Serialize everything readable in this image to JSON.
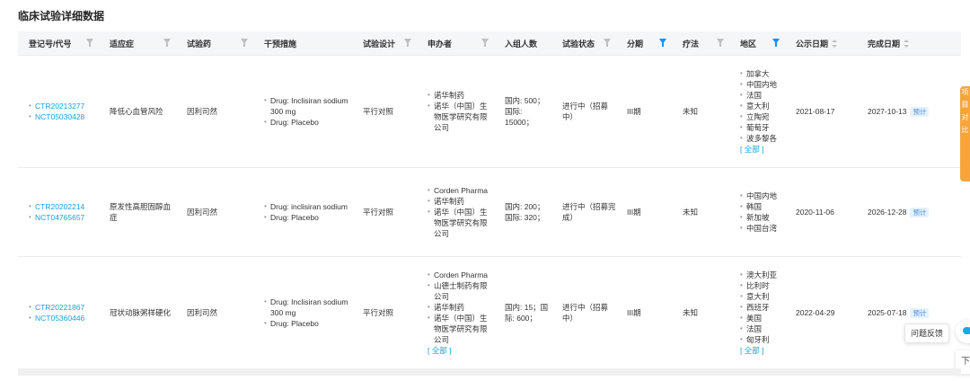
{
  "page": {
    "title": "临床试验详细数据"
  },
  "columns": [
    {
      "key": "reg_no",
      "label": "登记号/代号",
      "control": "filter"
    },
    {
      "key": "indication",
      "label": "适应症",
      "control": "filter"
    },
    {
      "key": "drug",
      "label": "试验药",
      "control": "filter"
    },
    {
      "key": "intervention",
      "label": "干预措施",
      "control": "none"
    },
    {
      "key": "design",
      "label": "试验设计",
      "control": "filter"
    },
    {
      "key": "sponsor",
      "label": "申办者",
      "control": "filter"
    },
    {
      "key": "enrollment",
      "label": "入组人数",
      "control": "none"
    },
    {
      "key": "status",
      "label": "试验状态",
      "control": "filter"
    },
    {
      "key": "phase",
      "label": "分期",
      "control": "filter-active"
    },
    {
      "key": "therapy",
      "label": "疗法",
      "control": "filter"
    },
    {
      "key": "region",
      "label": "地区",
      "control": "filter-active"
    },
    {
      "key": "publish_date",
      "label": "公示日期",
      "control": "sort"
    },
    {
      "key": "complete_date",
      "label": "完成日期",
      "control": "sort"
    }
  ],
  "rows": [
    {
      "reg_ids": [
        "CTR20213277",
        "NCT05030428"
      ],
      "indication": "降低心血管风险",
      "drug": "因利司然",
      "interventions": [
        "Drug: Inclisiran sodium 300 mg",
        "Drug: Placebo"
      ],
      "design": "平行对照",
      "sponsors": [
        "诺华制药",
        "诺华（中国）生物医学研究有限公司"
      ],
      "sponsor_more": "",
      "enrollment": "国内: 500；国际: 15000；",
      "status": "进行中（招募中）",
      "phase": "III期",
      "therapy": "未知",
      "regions": [
        "加拿大",
        "中国内地",
        "法国",
        "意大利",
        "立陶宛",
        "葡萄牙",
        "波多黎各"
      ],
      "region_more": "[ 全部 ]",
      "publish_date": "2021-08-17",
      "complete_date": "2027-10-13",
      "complete_tag": "预计"
    },
    {
      "reg_ids": [
        "CTR20202214",
        "NCT04765657"
      ],
      "indication": "原发性高胆固醇血症",
      "drug": "因利司然",
      "interventions": [
        "Drug: inclisiran sodium",
        "Drug: Placebo"
      ],
      "design": "平行对照",
      "sponsors": [
        "Corden Pharma",
        "诺华制药",
        "诺华（中国）生物医学研究有限公司"
      ],
      "sponsor_more": "",
      "enrollment": "国内: 200；国际: 320；",
      "status": "进行中（招募完成）",
      "phase": "III期",
      "therapy": "未知",
      "regions": [
        "中国内地",
        "韩国",
        "新加坡",
        "中国台湾"
      ],
      "region_more": "",
      "publish_date": "2020-11-06",
      "complete_date": "2026-12-28",
      "complete_tag": "预计"
    },
    {
      "reg_ids": [
        "CTR20221867",
        "NCT05360446"
      ],
      "indication": "冠状动脉粥样硬化",
      "drug": "因利司然",
      "interventions": [
        "Drug: Inclisiran sodium 300 mg",
        "Drug: Placebo"
      ],
      "design": "平行对照",
      "sponsors": [
        "Corden Pharma",
        "山德士制药有限公司",
        "诺华制药",
        "诺华（中国）生物医学研究有限公司"
      ],
      "sponsor_more": "[ 全部 ]",
      "enrollment": "国内: 15；国际: 600；",
      "status": "进行中（招募中）",
      "phase": "III期",
      "therapy": "未知",
      "regions": [
        "澳大利亚",
        "比利时",
        "意大利",
        "西班牙",
        "美国",
        "法国",
        "匈牙利"
      ],
      "region_more": "[ 全部 ]",
      "publish_date": "2022-04-29",
      "complete_date": "2025-07-18",
      "complete_tag": "预计"
    }
  ],
  "widgets": {
    "side_tab_text": "项目对比",
    "feedback_label": "问题反馈",
    "bottom_btn_label": "下",
    "accent_color": "#1a9fd8",
    "side_tab_color": "#f7a53b"
  }
}
